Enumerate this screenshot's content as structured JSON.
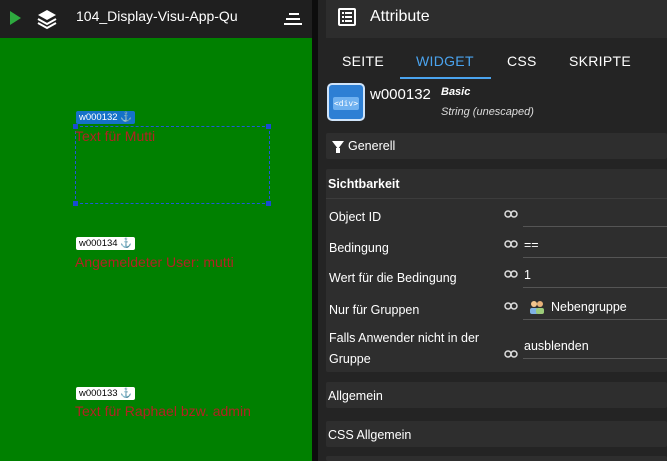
{
  "canvas": {
    "title": "104_Display-Visu-App-Qu",
    "widgets": [
      {
        "id_label": "w000132",
        "anchor": "⚓",
        "text": "Text für Mutti",
        "selected": true
      },
      {
        "id_label": "w000134",
        "anchor": "⚓",
        "text": "Angemeldeter User: mutti",
        "selected": false
      },
      {
        "id_label": "w000133",
        "anchor": "⚓",
        "text": "Text für Raphael bzw. admin",
        "selected": false
      }
    ],
    "background_color": "#008000",
    "text_color": "#b22222"
  },
  "attributes": {
    "header_title": "Attribute",
    "tabs": [
      "SEITE",
      "WIDGET",
      "CSS",
      "SKRIPTE"
    ],
    "active_tab": "WIDGET",
    "widget": {
      "badge_text": "<div>",
      "id": "w000132",
      "type": "Basic",
      "subtype": "String (unescaped)"
    },
    "sections": {
      "generell": "Generell",
      "sichtbarkeit": "Sichtbarkeit",
      "allgemein": "Allgemein",
      "css_allgemein": "CSS Allgemein"
    },
    "props": {
      "object_id": {
        "label": "Object ID",
        "value": ""
      },
      "bedingung": {
        "label": "Bedingung",
        "value": "=="
      },
      "wert": {
        "label": "Wert für die Bedingung",
        "value": "1"
      },
      "gruppen": {
        "label": "Nur für Gruppen",
        "value": "Nebengruppe"
      },
      "falls_line1": "Falls Anwender nicht in der",
      "falls_line2": "Gruppe",
      "falls_value": "ausblenden"
    },
    "accent_color": "#4aa3ee"
  }
}
